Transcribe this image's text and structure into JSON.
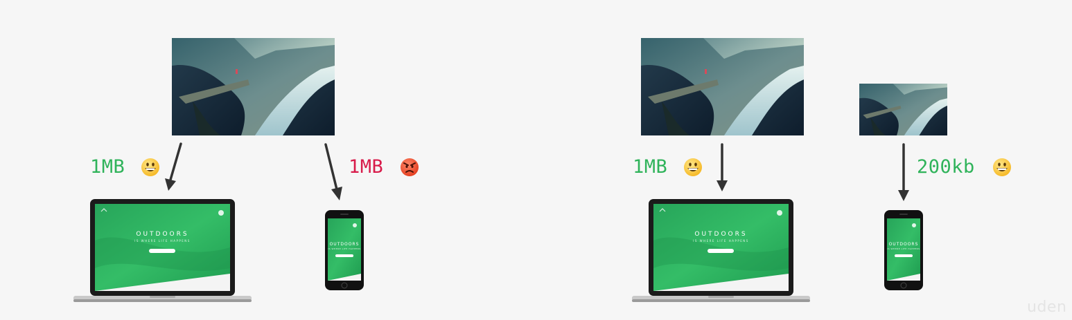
{
  "scenario_single": {
    "desktop": {
      "label": "1MB",
      "label_color": "#2fb35a",
      "reaction": "grinning-face"
    },
    "mobile": {
      "label": "1MB",
      "label_color": "#d81b4a",
      "reaction": "angry-face"
    }
  },
  "scenario_responsive": {
    "desktop": {
      "label": "1MB",
      "label_color": "#2fb35a",
      "reaction": "grinning-face"
    },
    "mobile": {
      "label": "200kb",
      "label_color": "#2fb35a",
      "reaction": "grinning-face"
    }
  },
  "device_screen": {
    "headline": "OUTDOORS",
    "tagline": "IS WHERE LIFE HAPPENS"
  },
  "watermark": "uden",
  "colors": {
    "screen_green": "#2db462",
    "arrow": "#333333",
    "background": "#f6f6f6"
  }
}
